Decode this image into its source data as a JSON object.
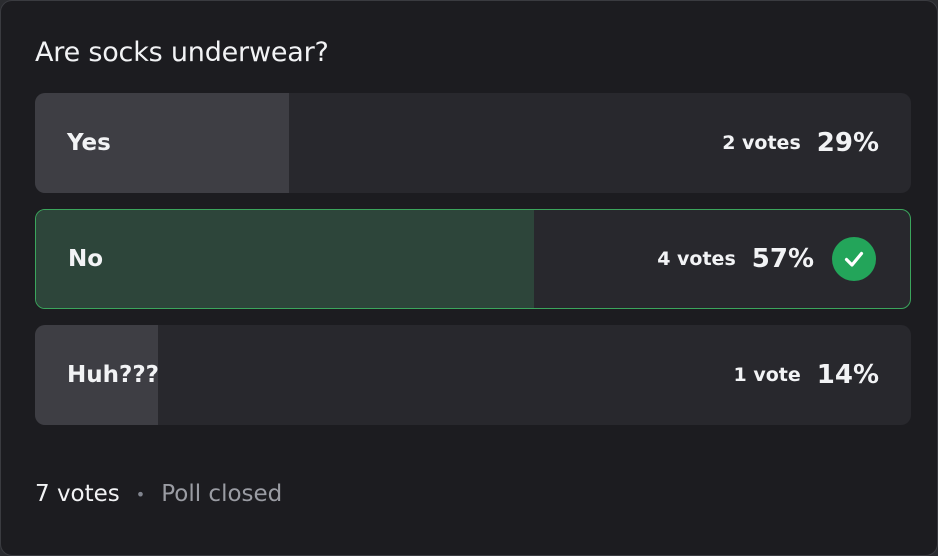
{
  "question": "Are socks underwear?",
  "answers": [
    {
      "label": "Yes",
      "votes": "2 votes",
      "percent": "29%",
      "fill": 0.29,
      "winner": false
    },
    {
      "label": "No",
      "votes": "4 votes",
      "percent": "57%",
      "fill": 0.57,
      "winner": true
    },
    {
      "label": "Huh???",
      "votes": "1 vote",
      "percent": "14%",
      "fill": 0.14,
      "winner": false
    }
  ],
  "footer": {
    "total_votes": "7 votes",
    "separator": "•",
    "status": "Poll closed"
  },
  "colors": {
    "winner_accent": "#23a55a",
    "winner_fill": "#2d453a",
    "bar_fill": "#3e3e44",
    "card_bg": "#1c1c20"
  },
  "icons": {
    "winner": "checkmark-circle-icon"
  }
}
